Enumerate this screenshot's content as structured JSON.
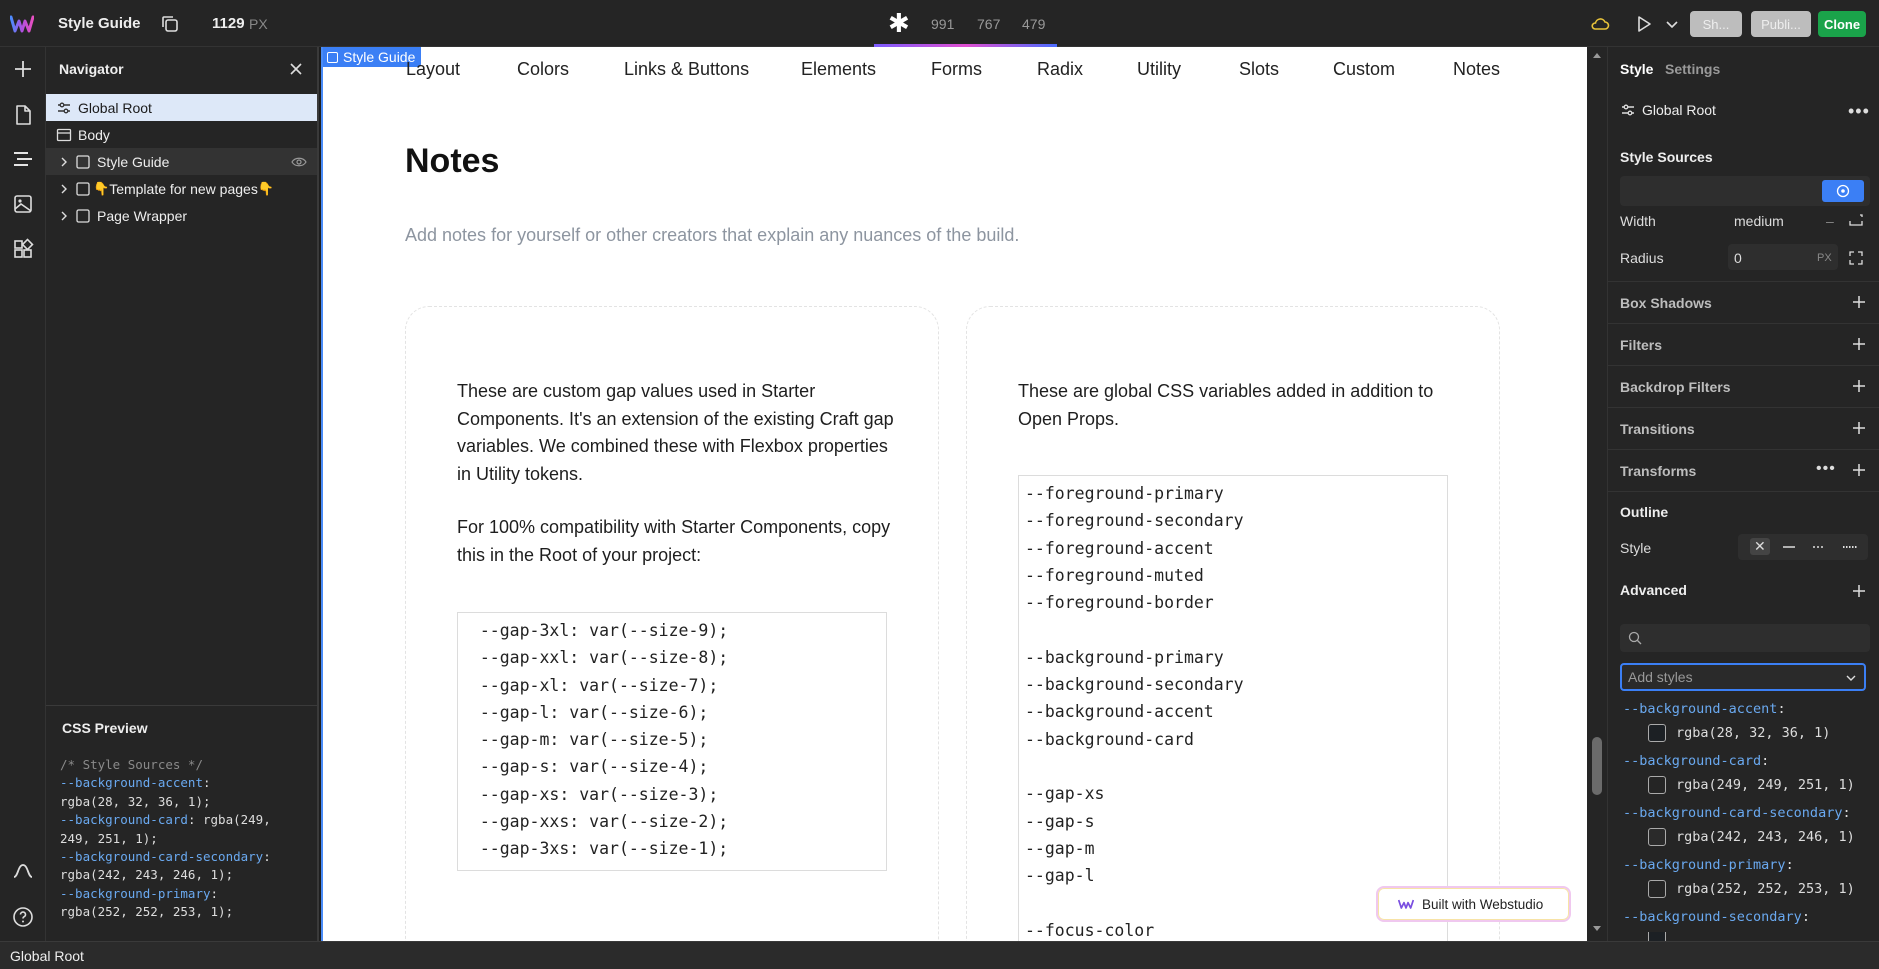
{
  "topbar": {
    "project_name": "Style Guide",
    "canvas_width": "1129",
    "canvas_unit": "PX",
    "breakpoints": [
      "991",
      "767",
      "479"
    ],
    "share_label": "Sh...",
    "publish_label": "Publi...",
    "clone_label": "Clone",
    "clone_color": "#1aa34a"
  },
  "navigator": {
    "title": "Navigator",
    "items": [
      {
        "label": "Global Root"
      },
      {
        "label": "Body"
      },
      {
        "label": "Style Guide"
      },
      {
        "label": "Template for new pages"
      },
      {
        "label": "Page Wrapper"
      }
    ],
    "template_emoji": "👇",
    "css_preview_title": "CSS Preview",
    "css_preview_lines": [
      {
        "comment": "/* Style Sources */"
      },
      {
        "prop": "--background-accent",
        "value": ""
      },
      {
        "value": "rgba(28, 32, 36, 1);"
      },
      {
        "prop": "--background-card",
        "value": " rgba(249,"
      },
      {
        "value": "249, 251, 1);"
      },
      {
        "prop": "--background-card-secondary",
        "value": ""
      },
      {
        "value": "rgba(242, 243, 246, 1);"
      },
      {
        "prop": "--background-primary",
        "value": ""
      },
      {
        "value": "rgba(252, 252, 253, 1);"
      }
    ]
  },
  "canvas": {
    "selected_label": "Style Guide",
    "nav_links": [
      "Layout",
      "Colors",
      "Links & Buttons",
      "Elements",
      "Forms",
      "Radix",
      "Utility",
      "Slots",
      "Custom",
      "Notes"
    ],
    "heading": "Notes",
    "subtitle": "Add notes for yourself or other creators that explain any nuances of the build.",
    "left_card": {
      "para1_lines": [
        "These are custom gap values used in Starter",
        "Components. It's an extension of the existing Craft gap",
        "variables. We combined these with Flexbox properties",
        "in Utility tokens."
      ],
      "para2_lines": [
        "For 100% compatibility with Starter Components, copy",
        "this in the Root of your project:"
      ],
      "code_lines": [
        "  --gap-3xl: var(--size-9);",
        "  --gap-xxl: var(--size-8);",
        "  --gap-xl: var(--size-7);",
        "  --gap-l: var(--size-6);",
        "  --gap-m: var(--size-5);",
        "  --gap-s: var(--size-4);",
        "  --gap-xs: var(--size-3);",
        "  --gap-xxs: var(--size-2);",
        "  --gap-3xs: var(--size-1);"
      ]
    },
    "right_card": {
      "para_lines": [
        "These are global CSS variables added in addition to",
        "Open Props."
      ],
      "code_lines": [
        "--foreground-primary",
        "--foreground-secondary",
        "--foreground-accent",
        "--foreground-muted",
        "--foreground-border",
        "",
        "--background-primary",
        "--background-secondary",
        "--background-accent",
        "--background-card",
        "",
        "--gap-xs",
        "--gap-s",
        "--gap-m",
        "--gap-l",
        "",
        "--focus-color"
      ]
    },
    "built_badge": "Built with Webstudio"
  },
  "right_panel": {
    "tab_style": "Style",
    "tab_settings": "Settings",
    "selected_instance": "Global Root",
    "style_sources_title": "Style Sources",
    "width_label": "Width",
    "width_value": "medium",
    "width_dash": "–",
    "radius_label": "Radius",
    "radius_value": "0",
    "radius_unit": "PX",
    "sections": [
      "Box Shadows",
      "Filters",
      "Backdrop Filters",
      "Transitions",
      "Transforms"
    ],
    "outline_title": "Outline",
    "style_label": "Style",
    "style_x": "✕",
    "advanced_title": "Advanced",
    "add_styles_placeholder": "Add styles",
    "variables": [
      {
        "name": "--background-accent",
        "value": "rgba(28, 32, 36, 1)",
        "color": "#1c2024"
      },
      {
        "name": "--background-card",
        "value": "rgba(249, 249, 251, 1)",
        "color": "#f9f9fb"
      },
      {
        "name": "--background-card-secondary",
        "value": "rgba(242, 243, 246, 1)",
        "color": "#f2f3f6"
      },
      {
        "name": "--background-primary",
        "value": "rgba(252, 252, 253, 1)",
        "color": "#fcfcfd"
      },
      {
        "name": "--background-secondary",
        "value": "",
        "color": "#1c2024"
      }
    ]
  },
  "statusbar": {
    "breadcrumb": "Global Root"
  },
  "colors": {
    "accent": "#3b7ff5",
    "selected_bg": "#dde8f8"
  }
}
